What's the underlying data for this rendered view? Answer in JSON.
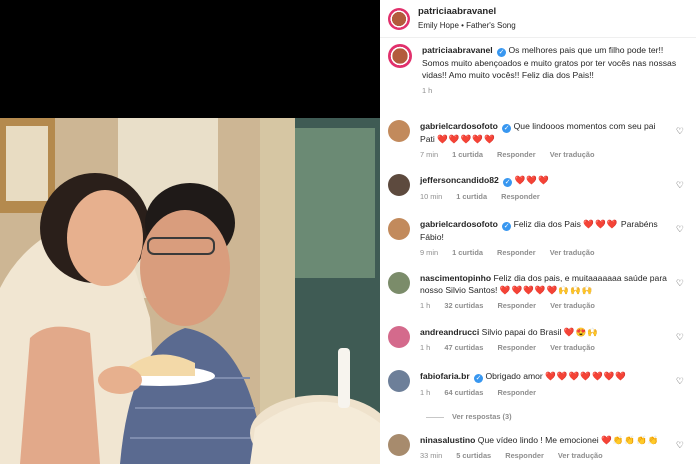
{
  "post": {
    "author": "patriciaabravanel",
    "audio": "Emily Hope • Father's Song",
    "caption": "Os melhores pais que um filho pode ter!! Somos muito abençoados e muito gratos por ter vocês nas nossas vidas!! Amo muito vocês!! Feliz dia dos Pais!!",
    "time": "1 h"
  },
  "comments": [
    {
      "user": "gabrielcardosofoto",
      "verified": true,
      "text": "Que lindooos momentos com seu pai Pati",
      "emoji": "❤️❤️❤️❤️❤️",
      "time": "7 min",
      "likes": "1 curtida",
      "reply": "Responder",
      "translate": "Ver tradução",
      "avatar_color": "#c28a5c"
    },
    {
      "user": "jeffersoncandido82",
      "verified": true,
      "text": "",
      "emoji": "❤️❤️❤️",
      "time": "10 min",
      "likes": "1 curtida",
      "reply": "Responder",
      "translate": "",
      "avatar_color": "#5d4a3e"
    },
    {
      "user": "gabrielcardosofoto",
      "verified": true,
      "text": "Feliz dia dos Pais",
      "emoji": "❤️❤️❤️",
      "text2": "Parabéns Fábio!",
      "time": "9 min",
      "likes": "1 curtida",
      "reply": "Responder",
      "translate": "Ver tradução",
      "avatar_color": "#c28a5c"
    },
    {
      "user": "nascimentopinho",
      "verified": false,
      "text": "Feliz dia dos pais, e muitaaaaaaa saúde para nosso Silvio Santos!",
      "emoji": "❤️❤️❤️❤️❤️🙌🙌🙌",
      "time": "1 h",
      "likes": "32 curtidas",
      "reply": "Responder",
      "translate": "Ver tradução",
      "avatar_color": "#7b8c6a"
    },
    {
      "user": "andreandrucci",
      "verified": false,
      "text": "Silvio papai do Brasil",
      "emoji": "❤️😍🙌",
      "time": "1 h",
      "likes": "47 curtidas",
      "reply": "Responder",
      "translate": "Ver tradução",
      "avatar_color": "#d46a8c"
    },
    {
      "user": "fabiofaria.br",
      "verified": true,
      "text": "Obrigado amor",
      "emoji": "❤️❤️❤️❤️❤️❤️❤️",
      "time": "1 h",
      "likes": "64 curtidas",
      "reply": "Responder",
      "translate": "",
      "avatar_color": "#6d7f99"
    },
    {
      "user": "ninasalustino",
      "verified": false,
      "text": "Que vídeo lindo ! Me emocionei",
      "emoji": "❤️👏👏👏👏",
      "time": "33 min",
      "likes": "5 curtidas",
      "reply": "Responder",
      "translate": "Ver tradução",
      "avatar_color": "#a78b6d"
    }
  ],
  "view_replies": "Ver respostas (3)",
  "colors": {
    "verified": "#3897f0",
    "heart": "#ed4956",
    "meta": "#8e8e8e"
  }
}
